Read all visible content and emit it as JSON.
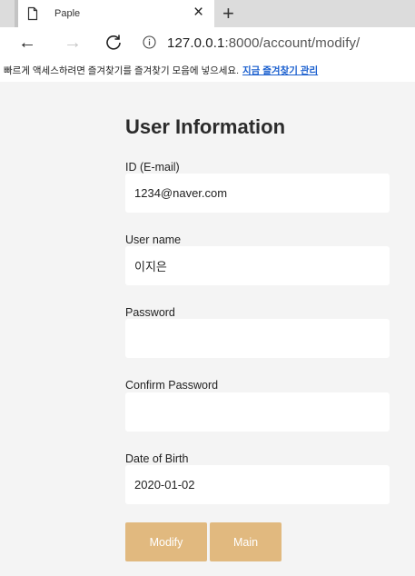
{
  "browser": {
    "tab_title": "Paple",
    "tab_close_glyph": "×",
    "new_tab_glyph": "+",
    "back_glyph": "←",
    "forward_glyph": "→",
    "url_host": "127.0.0.1",
    "url_path": ":8000/account/modify/",
    "bookmark_hint": "빠르게 액세스하려면 즐겨찾기를 즐겨찾기 모음에 넣으세요.",
    "bookmark_link": "지금 즐겨찾기 관리",
    "icons": {
      "tab": "page-icon",
      "reload": "reload-icon",
      "info": "info-icon"
    },
    "colors": {
      "link": "#1a5fcf"
    }
  },
  "form": {
    "title": "User Information",
    "fields": [
      {
        "label": "ID (E-mail)",
        "value": "1234@naver.com",
        "placeholder": ""
      },
      {
        "label": "User name",
        "value": "이지은",
        "placeholder": ""
      },
      {
        "label": "Password",
        "value": "",
        "placeholder": ""
      },
      {
        "label": "Confirm Password",
        "value": "",
        "placeholder": ""
      },
      {
        "label": "Date of Birth",
        "value": "2020-01-02",
        "placeholder": ""
      }
    ],
    "buttons": {
      "modify": "Modify",
      "main": "Main"
    },
    "colors": {
      "page_background": "#f4f4f4",
      "input_background": "#ffffff",
      "button": "#e1b97f",
      "button_text": "#ffffff"
    }
  }
}
